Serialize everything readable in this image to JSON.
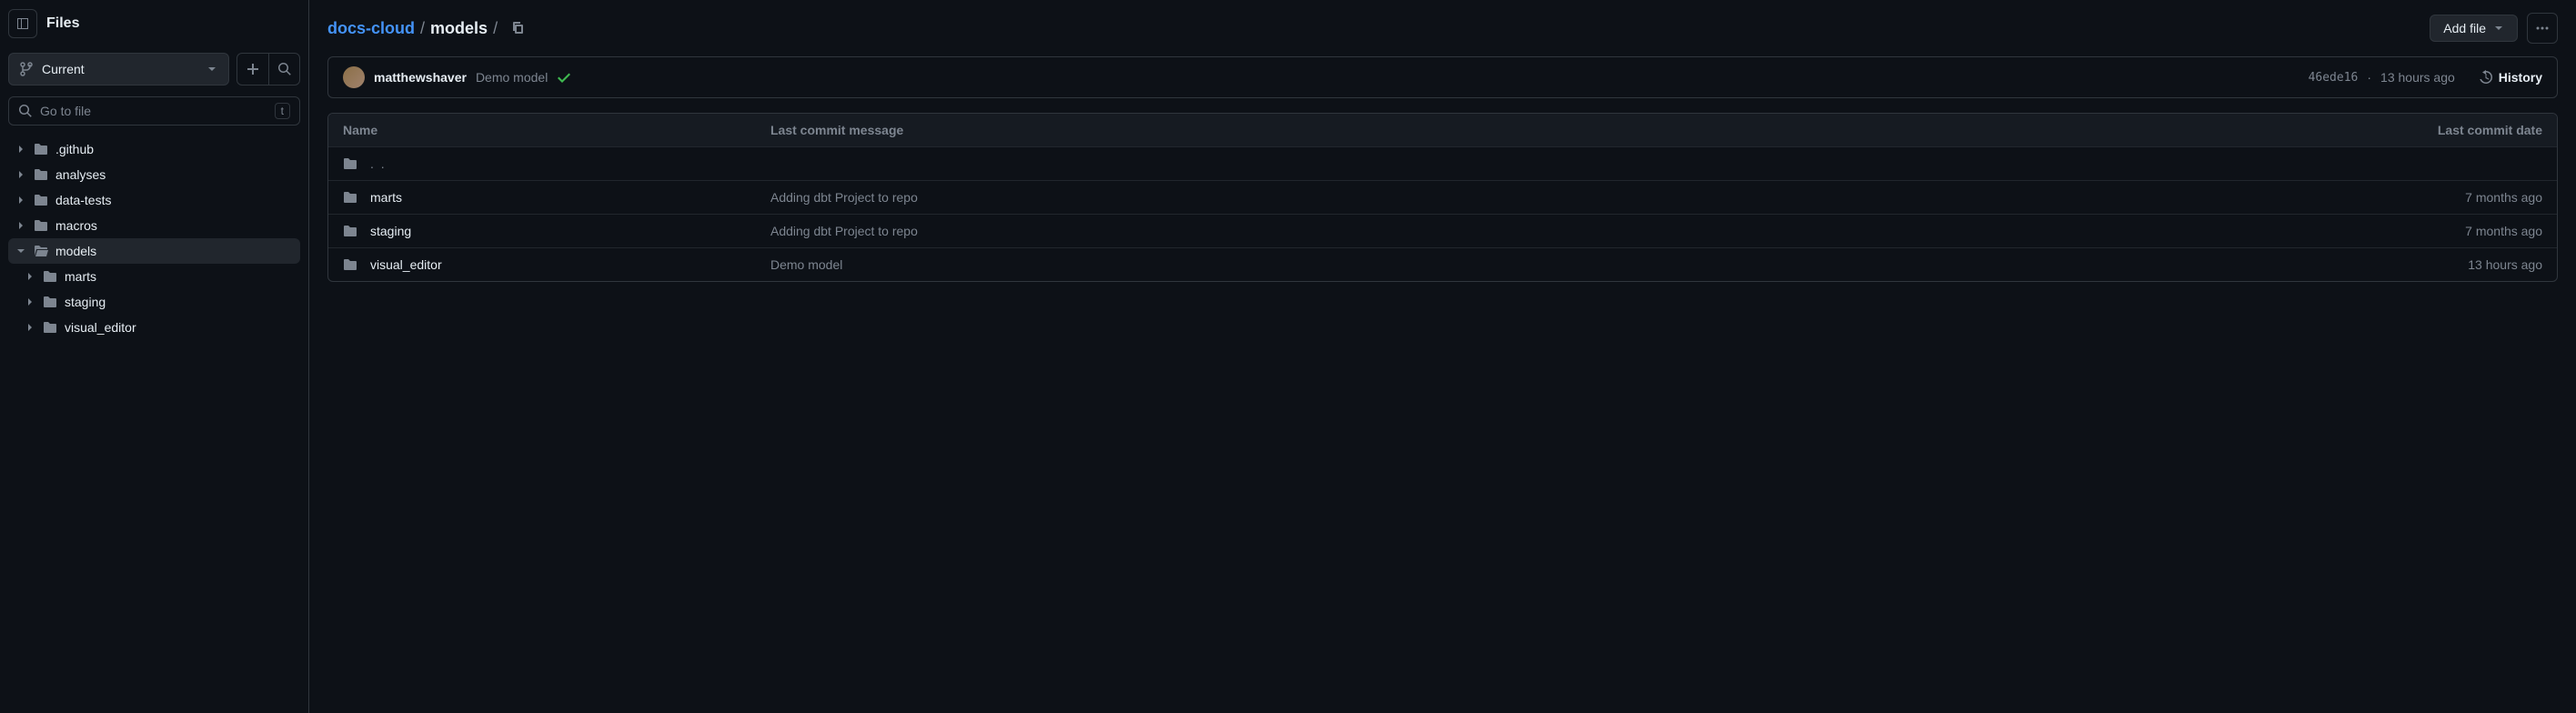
{
  "sidebar": {
    "title": "Files",
    "branch": "Current",
    "search_placeholder": "Go to file",
    "search_kbd": "t",
    "tree": [
      {
        "label": ".github",
        "expanded": false,
        "active": false,
        "nested": false
      },
      {
        "label": "analyses",
        "expanded": false,
        "active": false,
        "nested": false
      },
      {
        "label": "data-tests",
        "expanded": false,
        "active": false,
        "nested": false
      },
      {
        "label": "macros",
        "expanded": false,
        "active": false,
        "nested": false
      },
      {
        "label": "models",
        "expanded": true,
        "active": true,
        "nested": false
      },
      {
        "label": "marts",
        "expanded": false,
        "active": false,
        "nested": true
      },
      {
        "label": "staging",
        "expanded": false,
        "active": false,
        "nested": true
      },
      {
        "label": "visual_editor",
        "expanded": false,
        "active": false,
        "nested": true
      }
    ]
  },
  "breadcrumb": {
    "repo": "docs-cloud",
    "folder": "models"
  },
  "actions": {
    "add_file": "Add file"
  },
  "commit": {
    "author": "matthewshaver",
    "message": "Demo model",
    "sha": "46ede16",
    "sep": "·",
    "time": "13 hours ago",
    "history": "History"
  },
  "table": {
    "headers": {
      "name": "Name",
      "message": "Last commit message",
      "date": "Last commit date"
    },
    "parent": ". .",
    "rows": [
      {
        "name": "marts",
        "message": "Adding dbt Project to repo",
        "date": "7 months ago"
      },
      {
        "name": "staging",
        "message": "Adding dbt Project to repo",
        "date": "7 months ago"
      },
      {
        "name": "visual_editor",
        "message": "Demo model",
        "date": "13 hours ago"
      }
    ]
  }
}
